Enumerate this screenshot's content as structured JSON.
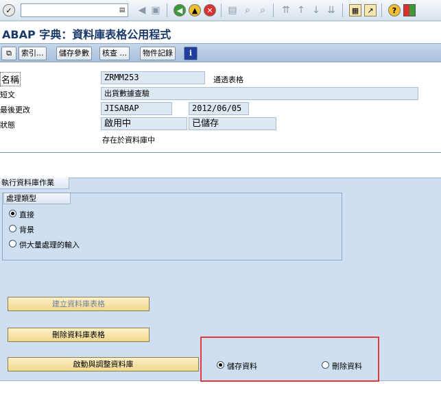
{
  "toolbar": {
    "command_field": {
      "value": "",
      "dropdown_icon": "dropdown-icon"
    },
    "icons": [
      "enter-icon",
      "save-icon",
      "back-icon",
      "exit-icon",
      "cancel-icon",
      "print-icon",
      "find-icon",
      "find-next-icon",
      "first-page-icon",
      "previous-page-icon",
      "next-page-icon",
      "last-page-icon",
      "new-session-icon",
      "shortcut-icon",
      "help-icon",
      "customize-layout-icon"
    ]
  },
  "title": "ABAP 字典：資料庫表格公用程式",
  "app_toolbar": {
    "buttons": [
      {
        "label": "索引..."
      },
      {
        "label": "儲存參數"
      },
      {
        "label": "核查 ..."
      },
      {
        "label": "物件記錄"
      }
    ]
  },
  "header": {
    "name_label": "名稱",
    "name_value": "ZRMM253",
    "name_type": "通透表格",
    "short_text_label": "短文",
    "short_text_value": "出貨數據查驗",
    "last_changed_label": "最後更改",
    "last_changed_user": "JISABAP",
    "last_changed_date": "2012/06/05",
    "status_label": "狀態",
    "status_value_1": "啟用中",
    "status_value_2": "已儲存",
    "exists_text": "存在於資料庫中"
  },
  "panel": {
    "tab_label": "執行資料庫作業",
    "group_label": "處理類型",
    "radios": [
      {
        "label": "直接",
        "selected": true
      },
      {
        "label": "背景",
        "selected": false
      },
      {
        "label": "供大量處理的輸入",
        "selected": false
      }
    ],
    "create_button": "建立資料庫表格",
    "delete_button": "刪除資料庫表格",
    "activate_button": "啟動與調整資料庫",
    "data_options": [
      {
        "label": "儲存資料",
        "selected": true
      },
      {
        "label": "刪除資料",
        "selected": false
      }
    ]
  },
  "colors": {
    "title": "#1b3a6b",
    "panel_bg": "#cddff0",
    "button_bg": "#f1d88e",
    "highlight_box": "#e2373f"
  }
}
